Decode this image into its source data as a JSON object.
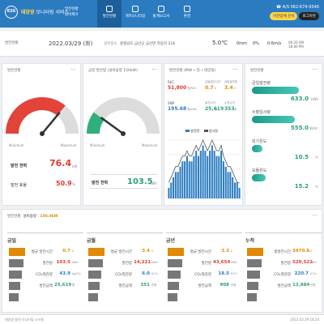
{
  "header": {
    "logo": "ESS",
    "brand_prefix": "태양광",
    "brand_rest": " 모니터링 서비스",
    "tabs": [
      "발전현황",
      "계측모니터링",
      "통계보고서",
      "환경"
    ],
    "phone": "☎ A/S 062-674-9546",
    "btn1": "이전업체 분석",
    "btn2": "로그아웃"
  },
  "sidebar_label": "발전현황",
  "sidebar_sub": "장비제어",
  "infobar": {
    "label": "발전현황",
    "date": "2022.03/29 (화)",
    "loc_label": "설치장소",
    "location": "충청남도 금산군 금산면 목동리 216",
    "temp": "5.0℃",
    "rain": "0mm",
    "humidity": "0%",
    "wind": "0.6m/s",
    "sunrise": "06:20 AM",
    "sunset": "18:00 PM"
  },
  "card1": {
    "title": "발전현황",
    "min": "Minimum",
    "max": "Maximum",
    "power_label": "발전 전력",
    "power": "76.4",
    "power_unit": "kW",
    "eff_label": "발전 효율",
    "eff": "50.9",
    "eff_unit": "%",
    "gauge_fraction": 0.72
  },
  "card2": {
    "title": "금일 발전량 (설비용량 150kW)",
    "min": "Minimum",
    "max": "Maximum",
    "label": "발전 전력",
    "value": "103.5",
    "unit": "kWh",
    "gauge_fraction": 0.2
  },
  "card3": {
    "title": "발전현황 (MW • 일 • 태양광)",
    "r1": [
      "REC",
      "51,800",
      "0.7",
      "3.4"
    ],
    "r2": [
      "SMP",
      "195.68",
      "25,619",
      "353"
    ],
    "units1": [
      "",
      "원/REC",
      "h",
      "h"
    ],
    "units2": [
      "",
      "원/kWh",
      "원",
      "원"
    ],
    "sub1": [
      "",
      "",
      "금일발전시간",
      "금일발전량"
    ],
    "sub2": [
      "",
      "",
      "발전수익",
      "누적수익"
    ],
    "legend": [
      "발전량",
      "일사량"
    ],
    "chart_data": {
      "type": "bar",
      "values": [
        2,
        3,
        4,
        5,
        5,
        6,
        7,
        7,
        8,
        7,
        7,
        8,
        9,
        8,
        9,
        10,
        9,
        8,
        9,
        10,
        9,
        8,
        8,
        9,
        7,
        6,
        5,
        5,
        4,
        3,
        3,
        2
      ],
      "line": [
        3,
        4,
        5,
        6,
        6,
        7,
        8,
        8,
        9,
        8,
        8,
        9,
        10,
        9,
        10,
        11,
        10,
        9,
        10,
        11,
        10,
        9,
        9,
        10,
        8,
        7,
        6,
        6,
        5,
        4,
        3,
        3
      ]
    }
  },
  "card4": {
    "title": "발전현황",
    "items": [
      {
        "label": "금일발전량",
        "value": "633.0",
        "unit": "kWh",
        "frac": 0.72
      },
      {
        "label": "수평일사량",
        "value": "555.0",
        "unit": "W/m²",
        "frac": 0.66
      },
      {
        "label": "외기온도",
        "value": "10.5",
        "unit": "℃",
        "frac": 0.16
      },
      {
        "label": "모듈온도",
        "value": "15.2",
        "unit": "℃",
        "frac": 0.21
      }
    ]
  },
  "sect": {
    "title": "발전현황",
    "cap_label": "설비용량 :",
    "cap": "150.0kW"
  },
  "periods": [
    {
      "name": "금일",
      "rows": [
        [
          "평균 발전시간",
          "0.7",
          "h"
        ],
        [
          "발전량",
          "103.5",
          "kWh"
        ],
        [
          "CO₂절감량",
          "43.9",
          "kgCO₂"
        ],
        [
          "발전금액",
          "25,619",
          "원"
        ]
      ]
    },
    {
      "name": "금월",
      "rows": [
        [
          "평균 발전시간",
          "3.4",
          "h"
        ],
        [
          "발전량",
          "14,221",
          "kWh"
        ],
        [
          "CO₂절감량",
          "6.0",
          "tCO₂"
        ],
        [
          "발전금액",
          "351",
          "만원"
        ]
      ]
    },
    {
      "name": "금년",
      "rows": [
        [
          "평균 발전시간",
          "3.3",
          "h"
        ],
        [
          "발전량",
          "43,654",
          "kWh"
        ],
        [
          "CO₂절감량",
          "18.5",
          "tCO₂"
        ],
        [
          "발전금액",
          "908",
          "만원"
        ]
      ]
    },
    {
      "name": "누적",
      "rows": [
        [
          "총발전시간",
          "3470.8",
          "h"
        ],
        [
          "발전량",
          "520,522",
          "kWh"
        ],
        [
          "CO₂절감량",
          "220.7",
          "tCO₂"
        ],
        [
          "발전금액",
          "12,884",
          "만원"
        ]
      ]
    }
  ],
  "footer": {
    "left": "태양광 발전 모니터링 시스템",
    "right": "2022.03.29 16:24"
  }
}
